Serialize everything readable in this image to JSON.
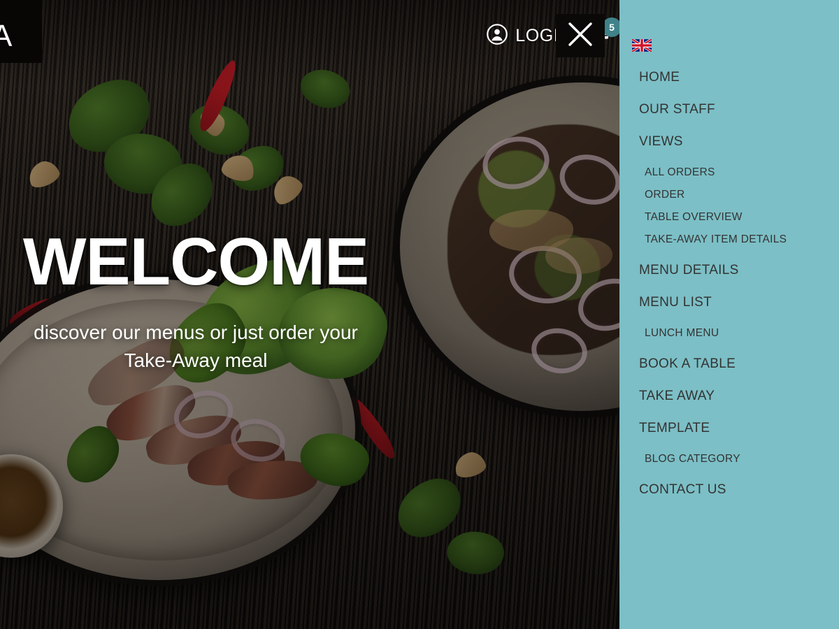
{
  "brand": {
    "logo_letter": "A"
  },
  "topbar": {
    "login_label": "LOGIN",
    "login_icon": "user-circle-icon",
    "cart_icon": "shopping-bag-icon",
    "cart_count": "5",
    "cart_badge_color": "#3f8289",
    "close_icon": "close-x-icon"
  },
  "hero": {
    "heading": "WELCOME",
    "tagline_line1": "discover our menus or just order your",
    "tagline_line2": "Take-Away meal",
    "background": "restaurant-food-photo"
  },
  "sidebar": {
    "background_color": "#7cbfc6",
    "text_color": "#333333",
    "language_flag": "uk-flag-icon",
    "items": [
      {
        "label": "HOME",
        "level": "top"
      },
      {
        "label": "OUR STAFF",
        "level": "top"
      },
      {
        "label": "VIEWS",
        "level": "top"
      },
      {
        "label": "ALL ORDERS",
        "level": "sub"
      },
      {
        "label": "ORDER",
        "level": "sub"
      },
      {
        "label": "TABLE OVERVIEW",
        "level": "sub"
      },
      {
        "label": "TAKE-AWAY ITEM DETAILS",
        "level": "sub"
      },
      {
        "label": "MENU DETAILS",
        "level": "top"
      },
      {
        "label": "MENU LIST",
        "level": "top"
      },
      {
        "label": "LUNCH MENU",
        "level": "sub"
      },
      {
        "label": "BOOK A TABLE",
        "level": "top"
      },
      {
        "label": "TAKE AWAY",
        "level": "top"
      },
      {
        "label": "TEMPLATE",
        "level": "top"
      },
      {
        "label": "BLOG CATEGORY",
        "level": "sub"
      },
      {
        "label": "CONTACT US",
        "level": "top"
      }
    ]
  }
}
